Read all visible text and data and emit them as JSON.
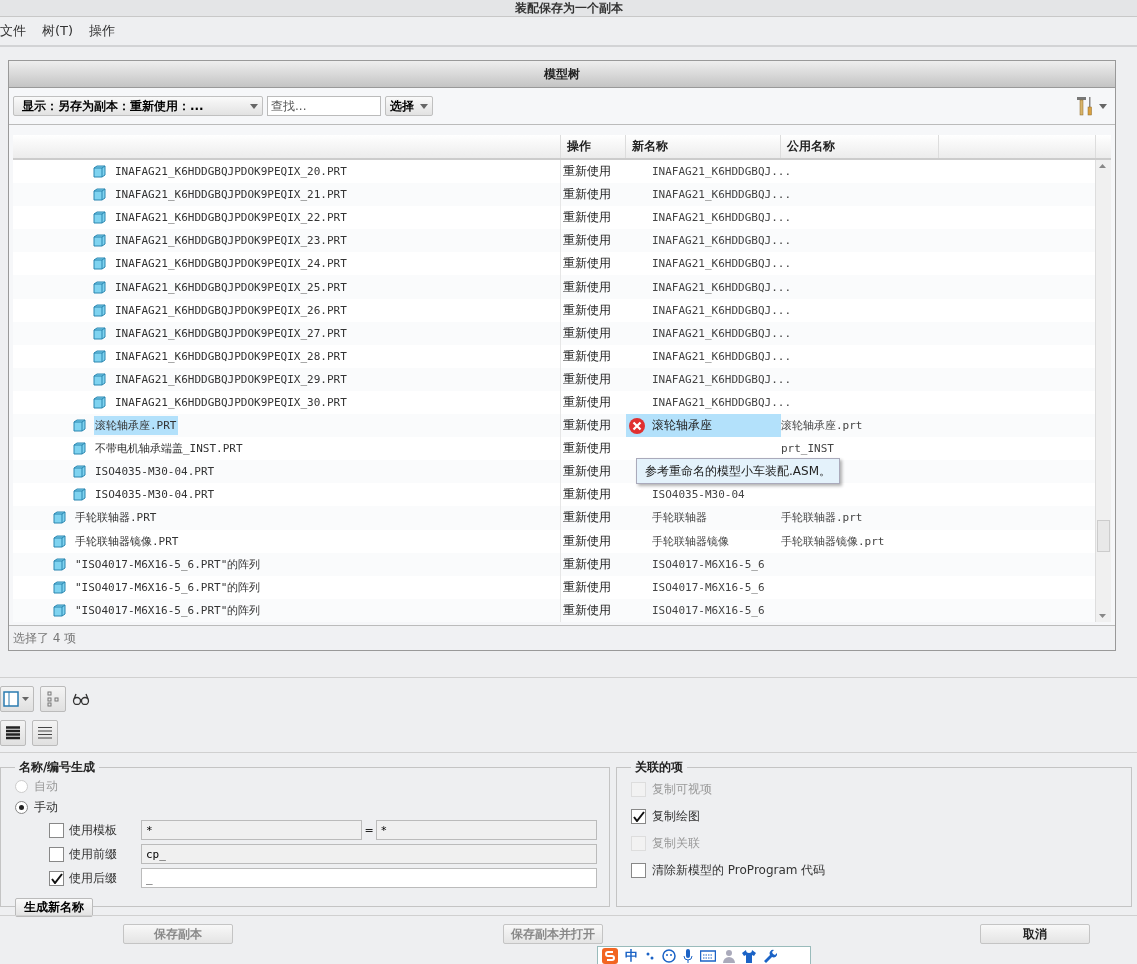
{
  "window": {
    "title": "装配保存为一个副本"
  },
  "menu": [
    "文件",
    "树(T)",
    "操作"
  ],
  "panel": {
    "title": "模型树",
    "display_dropdown": "显示：另存为副本：重新使用：...",
    "search": {
      "placeholder": "查找..."
    },
    "select_button": "选择"
  },
  "table": {
    "columns": [
      "操作",
      "新名称",
      "公用名称"
    ],
    "rows": [
      {
        "children": [
          {
            "children": [
              {
                "name": "INAFAG21_K6HDDGBQJPDOK9PEQIX_20.PRT",
                "action": "重新使用",
                "new_name": "INAFAG21_K6HDDGBQJ...",
                "selected": false
              },
              {
                "name": "INAFAG21_K6HDDGBQJPDOK9PEQIX_21.PRT",
                "action": "重新使用",
                "new_name": "INAFAG21_K6HDDGBQJ...",
                "selected": false
              },
              {
                "name": "INAFAG21_K6HDDGBQJPDOK9PEQIX_22.PRT",
                "action": "重新使用",
                "new_name": "INAFAG21_K6HDDGBQJ...",
                "selected": false
              },
              {
                "name": "INAFAG21_K6HDDGBQJPDOK9PEQIX_23.PRT",
                "action": "重新使用",
                "new_name": "INAFAG21_K6HDDGBQJ...",
                "selected": false
              },
              {
                "name": "INAFAG21_K6HDDGBQJPDOK9PEQIX_24.PRT",
                "action": "重新使用",
                "new_name": "INAFAG21_K6HDDGBQJ...",
                "selected": false
              },
              {
                "name": "INAFAG21_K6HDDGBQJPDOK9PEQIX_25.PRT",
                "action": "重新使用",
                "new_name": "INAFAG21_K6HDDGBQJ...",
                "selected": false
              },
              {
                "name": "INAFAG21_K6HDDGBQJPDOK9PEQIX_26.PRT",
                "action": "重新使用",
                "new_name": "INAFAG21_K6HDDGBQJ...",
                "selected": false
              },
              {
                "name": "INAFAG21_K6HDDGBQJPDOK9PEQIX_27.PRT",
                "action": "重新使用",
                "new_name": "INAFAG21_K6HDDGBQJ...",
                "selected": false
              },
              {
                "name": "INAFAG21_K6HDDGBQJPDOK9PEQIX_28.PRT",
                "action": "重新使用",
                "new_name": "INAFAG21_K6HDDGBQJ...",
                "selected": false
              },
              {
                "name": "INAFAG21_K6HDDGBQJPDOK9PEQIX_29.PRT",
                "action": "重新使用",
                "new_name": "INAFAG21_K6HDDGBQJ...",
                "selected": false
              },
              {
                "name": "INAFAG21_K6HDDGBQJPDOK9PEQIX_30.PRT",
                "action": "重新使用",
                "new_name": "INAFAG21_K6HDDGBQJ...",
                "selected": false
              }
            ]
          },
          {
            "name": "滚轮轴承座.PRT",
            "action": "重新使用",
            "new_name": "滚轮轴承座",
            "common_name": "滚轮轴承座.prt",
            "selected": true,
            "error": true
          },
          {
            "name": "不带电机轴承端盖_INST.PRT",
            "action": "重新使用",
            "common_name": "prt_INST",
            "selected": false
          },
          {
            "name": "ISO4035-M30-04.PRT",
            "action": "重新使用",
            "selected": false
          },
          {
            "name": "ISO4035-M30-04.PRT",
            "action": "重新使用",
            "new_name": "ISO4035-M30-04",
            "selected": false
          }
        ]
      },
      {
        "name": "手轮联轴器.PRT",
        "action": "重新使用",
        "new_name": "手轮联轴器",
        "common_name": "手轮联轴器.prt",
        "selected": false
      },
      {
        "name": "手轮联轴器镜像.PRT",
        "action": "重新使用",
        "new_name": "手轮联轴器镜像",
        "common_name": "手轮联轴器镜像.prt",
        "selected": false
      },
      {
        "name": "\"ISO4017-M6X16-5_6.PRT\"的阵列",
        "action": "重新使用",
        "new_name": "ISO4017-M6X16-5_6",
        "selected": false
      },
      {
        "name": "\"ISO4017-M6X16-5_6.PRT\"的阵列",
        "action": "重新使用",
        "new_name": "ISO4017-M6X16-5_6",
        "selected": false
      },
      {
        "name": "\"ISO4017-M6X16-5_6.PRT\"的阵列",
        "action": "重新使用",
        "new_name": "ISO4017-M6X16-5_6",
        "selected": false
      }
    ],
    "tooltip": "参考重命名的模型小车装配.ASM。"
  },
  "status": "选择了 4 项",
  "naming": {
    "title": "名称/编号生成",
    "radios": [
      {
        "label": "自动",
        "selected": false,
        "disabled": true
      },
      {
        "label": "手动",
        "selected": true,
        "disabled": false
      }
    ],
    "options": [
      {
        "label": "使用模板",
        "checked": false,
        "values": [
          "*",
          "*"
        ],
        "separator": "="
      },
      {
        "label": "使用前缀",
        "checked": false,
        "values": [
          "cp_"
        ]
      },
      {
        "label": "使用后缀",
        "checked": true,
        "values": [
          "_"
        ]
      }
    ],
    "button": "生成新名称"
  },
  "related": {
    "title": "关联的项",
    "items": [
      {
        "label": "复制可视项",
        "checked": false,
        "disabled": true
      },
      {
        "label": "复制绘图",
        "checked": true,
        "disabled": false
      },
      {
        "label": "复制关联",
        "checked": false,
        "disabled": true
      },
      {
        "label": "清除新模型的 ProProgram 代码",
        "checked": false,
        "disabled": false
      }
    ]
  },
  "buttons": [
    {
      "label": "保存副本",
      "disabled": true
    },
    {
      "label": "保存副本并打开",
      "disabled": true
    },
    {
      "label": "取消",
      "disabled": false
    }
  ],
  "ime_bar": {
    "label": "中"
  }
}
